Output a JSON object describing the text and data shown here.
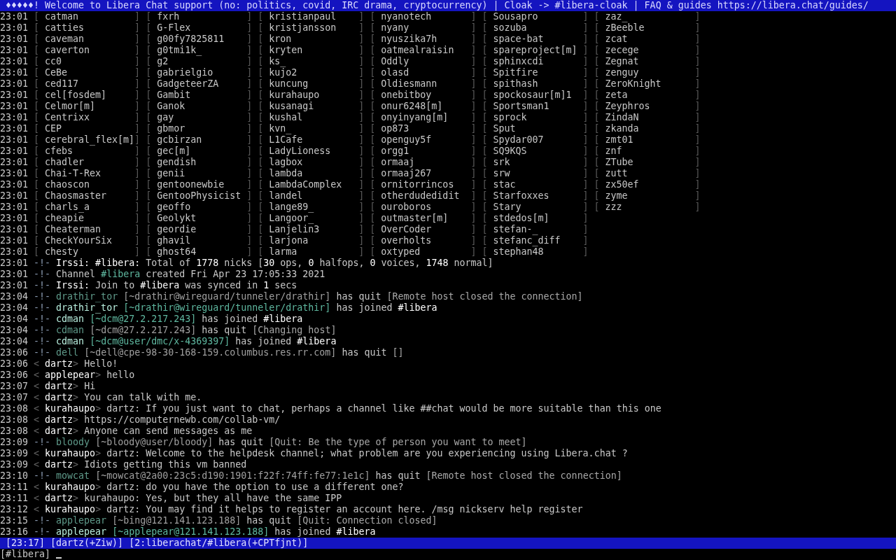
{
  "topic": "♦♦♦♦♦! Welcome to Libera Chat support (no: politics, covid, IRC drama, cryptocurrency) | Cloak -> #libera-cloak | FAQ & guides https://libera.chat/guides/",
  "nick_rows": [
    {
      "time": "23:01",
      "entries": [
        {
          "open": "[",
          "nick": "catman",
          "close": "]"
        },
        {
          "open": "[",
          "nick": "fxrh",
          "close": "]"
        },
        {
          "open": "[",
          "nick": "kristianpaul",
          "close": "]"
        },
        {
          "open": "[",
          "nick": "nyanotech",
          "close": "]"
        },
        {
          "open": "[",
          "nick": "Sousapro",
          "close": "]"
        },
        {
          "open": "[",
          "nick": "zaz_",
          "close": "]"
        }
      ]
    },
    {
      "time": "23:01",
      "entries": [
        {
          "open": "[",
          "nick": "catties",
          "close": "]"
        },
        {
          "open": "[",
          "nick": "G-Flex",
          "close": "]"
        },
        {
          "open": "[",
          "nick": "kristjansson",
          "close": "]"
        },
        {
          "open": "[",
          "nick": "nyany",
          "close": "]"
        },
        {
          "open": "[",
          "nick": "sozuba",
          "close": "]"
        },
        {
          "open": "[",
          "nick": "zBeeble",
          "close": "]"
        }
      ]
    },
    {
      "time": "23:01",
      "entries": [
        {
          "open": "[",
          "nick": "caveman",
          "close": "]"
        },
        {
          "open": "[",
          "nick": "g00fy7825811",
          "close": "]"
        },
        {
          "open": "[",
          "nick": "kron",
          "close": "]"
        },
        {
          "open": "[",
          "nick": "nyuszika7h",
          "close": "]"
        },
        {
          "open": "[",
          "nick": "space-bat",
          "close": "]"
        },
        {
          "open": "[",
          "nick": "zcat",
          "close": "]"
        }
      ]
    },
    {
      "time": "23:01",
      "entries": [
        {
          "open": "[",
          "nick": "caverton",
          "close": "]"
        },
        {
          "open": "[",
          "nick": "g0tmi1k_",
          "close": "]"
        },
        {
          "open": "[",
          "nick": "kryten",
          "close": "]"
        },
        {
          "open": "[",
          "nick": "oatmealraisin",
          "close": "]"
        },
        {
          "open": "[",
          "nick": "spareproject[m]",
          "close": "]"
        },
        {
          "open": "[",
          "nick": "zecege",
          "close": "]"
        }
      ]
    },
    {
      "time": "23:01",
      "entries": [
        {
          "open": "[",
          "nick": "cc0",
          "close": "]"
        },
        {
          "open": "[",
          "nick": "g2",
          "close": "]"
        },
        {
          "open": "[",
          "nick": "ks_",
          "close": "]"
        },
        {
          "open": "[",
          "nick": "Oddly",
          "close": "]"
        },
        {
          "open": "[",
          "nick": "sphinxcdi",
          "close": "]"
        },
        {
          "open": "[",
          "nick": "Zegnat",
          "close": "]"
        }
      ]
    },
    {
      "time": "23:01",
      "entries": [
        {
          "open": "[",
          "nick": "CeBe",
          "close": "]"
        },
        {
          "open": "[",
          "nick": "gabrielgio",
          "close": "]"
        },
        {
          "open": "[",
          "nick": "kujo2",
          "close": "]"
        },
        {
          "open": "[",
          "nick": "olasd",
          "close": "]"
        },
        {
          "open": "[",
          "nick": "Spitfire",
          "close": "]"
        },
        {
          "open": "[",
          "nick": "zenguy",
          "close": "]"
        }
      ]
    },
    {
      "time": "23:01",
      "entries": [
        {
          "open": "[",
          "nick": "ced117",
          "close": "]"
        },
        {
          "open": "[",
          "nick": "GadgeteerZA",
          "close": "]"
        },
        {
          "open": "[",
          "nick": "kuncung",
          "close": "]"
        },
        {
          "open": "[",
          "nick": "Oldiesmann",
          "close": "]"
        },
        {
          "open": "[",
          "nick": "spithash",
          "close": "]"
        },
        {
          "open": "[",
          "nick": "ZeroKnight",
          "close": "]"
        }
      ]
    },
    {
      "time": "23:01",
      "entries": [
        {
          "open": "[",
          "nick": "cel[fosdem]",
          "close": "]"
        },
        {
          "open": "[",
          "nick": "Gambit",
          "close": "]"
        },
        {
          "open": "[",
          "nick": "kurahaupo",
          "close": "]"
        },
        {
          "open": "[",
          "nick": "onebitboy",
          "close": "]"
        },
        {
          "open": "[",
          "nick": "spockosaur[m]1",
          "close": "]"
        },
        {
          "open": "[",
          "nick": "zeta",
          "close": "]"
        }
      ]
    },
    {
      "time": "23:01",
      "entries": [
        {
          "open": "[",
          "nick": "Celmor[m]",
          "close": "]"
        },
        {
          "open": "[",
          "nick": "Ganok",
          "close": "]"
        },
        {
          "open": "[",
          "nick": "kusanagi",
          "close": "]"
        },
        {
          "open": "[",
          "nick": "onur6248[m]",
          "close": "]"
        },
        {
          "open": "[",
          "nick": "Sportsman1",
          "close": "]"
        },
        {
          "open": "[",
          "nick": "Zeyphros",
          "close": "]"
        }
      ]
    },
    {
      "time": "23:01",
      "entries": [
        {
          "open": "[",
          "nick": "Centrixx",
          "close": "]"
        },
        {
          "open": "[",
          "nick": "gay",
          "close": "]"
        },
        {
          "open": "[",
          "nick": "kushal",
          "close": "]"
        },
        {
          "open": "[",
          "nick": "onyinyang[m]",
          "close": "]"
        },
        {
          "open": "[",
          "nick": "sprock",
          "close": "]"
        },
        {
          "open": "[",
          "nick": "ZindaN",
          "close": "]"
        }
      ]
    },
    {
      "time": "23:01",
      "entries": [
        {
          "open": "[",
          "nick": "CEP",
          "close": "]"
        },
        {
          "open": "[",
          "nick": "gbmor",
          "close": "]"
        },
        {
          "open": "[",
          "nick": "kvn_",
          "close": "]"
        },
        {
          "open": "[",
          "nick": "op873",
          "close": "]"
        },
        {
          "open": "[",
          "nick": "Sput",
          "close": "]"
        },
        {
          "open": "[",
          "nick": "zkanda",
          "close": "]"
        }
      ]
    },
    {
      "time": "23:01",
      "entries": [
        {
          "open": "[",
          "nick": "cerebral_flex[m]",
          "close": "]"
        },
        {
          "open": "[",
          "nick": "gcbirzan",
          "close": "]"
        },
        {
          "open": "[",
          "nick": "L1Cafe",
          "close": "]"
        },
        {
          "open": "[",
          "nick": "openguy5f",
          "close": "]"
        },
        {
          "open": "[",
          "nick": "Spydar007",
          "close": "]"
        },
        {
          "open": "[",
          "nick": "zmt01",
          "close": "]"
        }
      ]
    },
    {
      "time": "23:01",
      "entries": [
        {
          "open": "[",
          "nick": "cfebs",
          "close": "]"
        },
        {
          "open": "[",
          "nick": "gec[m]",
          "close": "]"
        },
        {
          "open": "[",
          "nick": "LadyLioness",
          "close": "]"
        },
        {
          "open": "[",
          "nick": "orgg1",
          "close": "]"
        },
        {
          "open": "[",
          "nick": "SQ9KQS",
          "close": "]"
        },
        {
          "open": "[",
          "nick": "znf",
          "close": "]"
        }
      ]
    },
    {
      "time": "23:01",
      "entries": [
        {
          "open": "[",
          "nick": "chadler",
          "close": "]"
        },
        {
          "open": "[",
          "nick": "gendish",
          "close": "]"
        },
        {
          "open": "[",
          "nick": "lagbox",
          "close": "]"
        },
        {
          "open": "[",
          "nick": "ormaaj",
          "close": "]"
        },
        {
          "open": "[",
          "nick": "srk",
          "close": "]"
        },
        {
          "open": "[",
          "nick": "ZTube",
          "close": "]"
        }
      ]
    },
    {
      "time": "23:01",
      "entries": [
        {
          "open": "[",
          "nick": "Chai-T-Rex",
          "close": "]"
        },
        {
          "open": "[",
          "nick": "genii",
          "close": "]"
        },
        {
          "open": "[",
          "nick": "lambda",
          "close": "]"
        },
        {
          "open": "[",
          "nick": "ormaaj267",
          "close": "]"
        },
        {
          "open": "[",
          "nick": "srw",
          "close": "]"
        },
        {
          "open": "[",
          "nick": "zutt",
          "close": "]"
        }
      ]
    },
    {
      "time": "23:01",
      "entries": [
        {
          "open": "[",
          "nick": "chaoscon",
          "close": "]"
        },
        {
          "open": "[",
          "nick": "gentoonewbie",
          "close": "]"
        },
        {
          "open": "[",
          "nick": "LambdaComplex",
          "close": "]"
        },
        {
          "open": "[",
          "nick": "ornitorrincos",
          "close": "]"
        },
        {
          "open": "[",
          "nick": "stac",
          "close": "]"
        },
        {
          "open": "[",
          "nick": "zx50ef",
          "close": "]"
        }
      ]
    },
    {
      "time": "23:01",
      "entries": [
        {
          "open": "[",
          "nick": "Chaosmaster",
          "close": "]"
        },
        {
          "open": "[",
          "nick": "GentooPhysicist",
          "close": "]"
        },
        {
          "open": "[",
          "nick": "landel",
          "close": "]"
        },
        {
          "open": "[",
          "nick": "otherdudedidit",
          "close": "]"
        },
        {
          "open": "[",
          "nick": "Starfoxxes",
          "close": "]"
        },
        {
          "open": "[",
          "nick": "zyme",
          "close": "]"
        }
      ]
    },
    {
      "time": "23:01",
      "entries": [
        {
          "open": "[",
          "nick": "charls_a",
          "close": "]"
        },
        {
          "open": "[",
          "nick": "geoffo",
          "close": "]"
        },
        {
          "open": "[",
          "nick": "lange89_",
          "close": "]"
        },
        {
          "open": "[",
          "nick": "ouroboros",
          "close": "]"
        },
        {
          "open": "[",
          "nick": "Stary",
          "close": "]"
        },
        {
          "open": "[",
          "nick": "zzz",
          "close": "]"
        }
      ]
    },
    {
      "time": "23:01",
      "entries": [
        {
          "open": "[",
          "nick": "cheapie",
          "close": "]"
        },
        {
          "open": "[",
          "nick": "Geolykt",
          "close": "]"
        },
        {
          "open": "[",
          "nick": "Langoor_",
          "close": "]"
        },
        {
          "open": "[",
          "nick": "outmaster[m]",
          "close": "]"
        },
        {
          "open": "[",
          "nick": "stdedos[m]",
          "close": "]"
        }
      ]
    },
    {
      "time": "23:01",
      "entries": [
        {
          "open": "[",
          "nick": "Cheaterman",
          "close": "]"
        },
        {
          "open": "[",
          "nick": "geordie",
          "close": "]"
        },
        {
          "open": "[",
          "nick": "Lanjelin3",
          "close": "]"
        },
        {
          "open": "[",
          "nick": "OverCoder",
          "close": "]"
        },
        {
          "open": "[",
          "nick": "stefan-_",
          "close": "]"
        }
      ]
    },
    {
      "time": "23:01",
      "entries": [
        {
          "open": "[",
          "nick": "CheckYourSix",
          "close": "]"
        },
        {
          "open": "[",
          "nick": "ghavil",
          "close": "]"
        },
        {
          "open": "[",
          "nick": "larjona",
          "close": "]"
        },
        {
          "open": "[",
          "nick": "overholts",
          "close": "]"
        },
        {
          "open": "[",
          "nick": "stefanc_diff",
          "close": "]"
        }
      ]
    },
    {
      "time": "23:01",
      "entries": [
        {
          "open": "[",
          "nick": "chesty",
          "close": "]"
        },
        {
          "open": "[",
          "nick": "ghost64",
          "close": "]"
        },
        {
          "open": "[",
          "nick": "larma",
          "close": "]"
        },
        {
          "open": "[",
          "nick": "oxtyped",
          "close": "]"
        },
        {
          "open": "[",
          "nick": "stephan48",
          "close": "]"
        }
      ]
    }
  ],
  "lines": [
    {
      "time": "23:01",
      "kind": "event",
      "marker": "-!-",
      "segments": [
        {
          "kind": "plain",
          "text": "**Irssi: #libera:** Total of **1778** nicks [**30** ops, **0** halfops, **0** voices, **1748** normal]"
        }
      ]
    },
    {
      "time": "23:01",
      "kind": "event",
      "marker": "-!-",
      "segments": [
        {
          "kind": "plain",
          "text": "Channel"
        },
        {
          "kind": "channel",
          "text": "#libera"
        },
        {
          "kind": "plain",
          "text": "created Fri Apr 23 17:05:33 2021"
        }
      ]
    },
    {
      "time": "23:01",
      "kind": "event",
      "marker": "-!-",
      "segments": [
        {
          "kind": "plain",
          "text": "**Irssi:** Join to **#libera** was synced in **1** secs"
        }
      ]
    },
    {
      "time": "23:04",
      "kind": "event",
      "marker": "-!-",
      "segments": [
        {
          "kind": "quit_nick",
          "text": "drathir_tor"
        },
        {
          "kind": "quit_host",
          "text": "[~drathir@wireguard/tunneler/drathir]"
        },
        {
          "kind": "plain",
          "text": "has quit"
        },
        {
          "kind": "reason",
          "text": "[Remote host closed the connection]"
        }
      ]
    },
    {
      "time": "23:04",
      "kind": "event",
      "marker": "-!-",
      "segments": [
        {
          "kind": "join_nick",
          "text": "drathir_tor"
        },
        {
          "kind": "join_host",
          "text": "[~drathir@wireguard/tunneler/drathir]"
        },
        {
          "kind": "plain",
          "text": "has joined **#libera**"
        }
      ]
    },
    {
      "time": "23:04",
      "kind": "event",
      "marker": "-!-",
      "segments": [
        {
          "kind": "join_nick",
          "text": "cdman"
        },
        {
          "kind": "join_host",
          "text": "[~dcm@27.2.217.243]"
        },
        {
          "kind": "plain",
          "text": "has joined **#libera**"
        }
      ]
    },
    {
      "time": "23:04",
      "kind": "event",
      "marker": "-!-",
      "segments": [
        {
          "kind": "quit_nick",
          "text": "cdman"
        },
        {
          "kind": "quit_host",
          "text": "[~dcm@27.2.217.243]"
        },
        {
          "kind": "plain",
          "text": "has quit"
        },
        {
          "kind": "reason",
          "text": "[Changing host]"
        }
      ]
    },
    {
      "time": "23:04",
      "kind": "event",
      "marker": "-!-",
      "segments": [
        {
          "kind": "join_nick",
          "text": "cdman"
        },
        {
          "kind": "join_host",
          "text": "[~dcm@user/dmc/x-4369397]"
        },
        {
          "kind": "plain",
          "text": "has joined **#libera**"
        }
      ]
    },
    {
      "time": "23:06",
      "kind": "event",
      "marker": "-!-",
      "segments": [
        {
          "kind": "quit_nick",
          "text": "dell"
        },
        {
          "kind": "quit_host",
          "text": "[~dell@cpe-98-30-168-159.columbus.res.rr.com]"
        },
        {
          "kind": "plain",
          "text": "has quit"
        },
        {
          "kind": "reason",
          "text": "[]"
        }
      ]
    },
    {
      "time": "23:06",
      "kind": "message",
      "open": "<",
      "nick": "dartz",
      "close": ">",
      "text": "Hello!"
    },
    {
      "time": "23:06",
      "kind": "message",
      "open": "<",
      "nick": "applepear",
      "close": ">",
      "text": "hello"
    },
    {
      "time": "23:07",
      "kind": "message",
      "open": "<",
      "nick": "dartz",
      "close": ">",
      "text": "Hi"
    },
    {
      "time": "23:07",
      "kind": "message",
      "open": "<",
      "nick": "dartz",
      "close": ">",
      "text": "You can talk with me."
    },
    {
      "time": "23:08",
      "kind": "message",
      "open": "<",
      "nick": "kurahaupo",
      "close": ">",
      "text": "dartz: If you just want to chat, perhaps a channel like ##chat would be more suitable than this one"
    },
    {
      "time": "23:08",
      "kind": "message",
      "open": "<",
      "nick": "dartz",
      "close": ">",
      "text": "https://computernewb.com/collab-vm/"
    },
    {
      "time": "23:08",
      "kind": "message",
      "open": "<",
      "nick": "dartz",
      "close": ">",
      "text": "Anyone can send messages as me"
    },
    {
      "time": "23:09",
      "kind": "event",
      "marker": "-!-",
      "segments": [
        {
          "kind": "quit_nick",
          "text": "bloody"
        },
        {
          "kind": "quit_host",
          "text": "[~bloody@user/bloody]"
        },
        {
          "kind": "plain",
          "text": "has quit"
        },
        {
          "kind": "reason",
          "text": "[Quit: Be the type of person you want to meet]"
        }
      ]
    },
    {
      "time": "23:09",
      "kind": "message",
      "open": "<",
      "nick": "kurahaupo",
      "close": ">",
      "text": "dartz: Welcome to the helpdesk channel; what problem are you experiencing using Libera.chat ?"
    },
    {
      "time": "23:09",
      "kind": "message",
      "open": "<",
      "nick": "dartz",
      "close": ">",
      "text": "Idiots getting this vm banned"
    },
    {
      "time": "23:10",
      "kind": "event",
      "marker": "-!-",
      "segments": [
        {
          "kind": "quit_nick",
          "text": "mowcat"
        },
        {
          "kind": "quit_host",
          "text": "[~mowcat@2a00:23c5:d190:1901:f22f:74ff:fe77:1e1c]"
        },
        {
          "kind": "plain",
          "text": "has quit"
        },
        {
          "kind": "reason",
          "text": "[Remote host closed the connection]"
        }
      ]
    },
    {
      "time": "23:11",
      "kind": "message",
      "open": "<",
      "nick": "kurahaupo",
      "close": ">",
      "text": "dartz: do you have the option to use a different one?"
    },
    {
      "time": "23:11",
      "kind": "message",
      "open": "<",
      "nick": "dartz",
      "close": ">",
      "text": "kurahaupo: Yes, but they all have the same IPP"
    },
    {
      "time": "23:12",
      "kind": "message",
      "open": "<",
      "nick": "kurahaupo",
      "close": ">",
      "text": "dartz: You may find it helps to register an account here. /msg nickserv help register"
    },
    {
      "time": "23:15",
      "kind": "event",
      "marker": "-!-",
      "segments": [
        {
          "kind": "quit_nick",
          "text": "applepear"
        },
        {
          "kind": "quit_host",
          "text": "[~bing@121.141.123.188]"
        },
        {
          "kind": "plain",
          "text": "has quit"
        },
        {
          "kind": "reason",
          "text": "[Quit: Connection closed]"
        }
      ]
    },
    {
      "time": "23:16",
      "kind": "event",
      "marker": "-!-",
      "segments": [
        {
          "kind": "join_nick",
          "text": "applepear"
        },
        {
          "kind": "join_host",
          "text": "[~applepear@121.141.123.188]"
        },
        {
          "kind": "plain",
          "text": "has joined **#libera**"
        }
      ]
    }
  ],
  "status_bar": [
    "[23:17]",
    "[dartz(+Ziw)]",
    "[2:liberachat/#libera(+CPTfjnt)]"
  ],
  "prompt": "[#libera]"
}
